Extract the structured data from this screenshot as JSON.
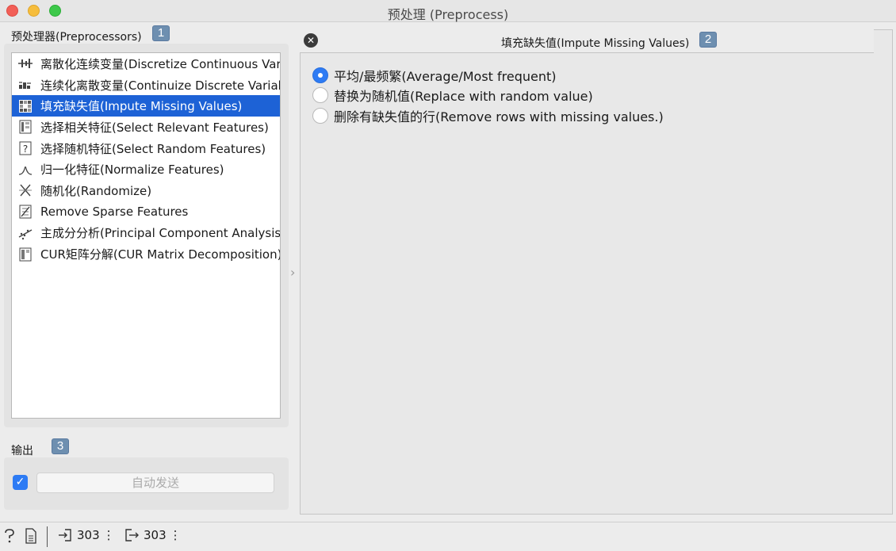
{
  "window": {
    "title": "预处理 (Preprocess)"
  },
  "preprocessors": {
    "label": "预处理器(Preprocessors)",
    "badge": "1",
    "items": [
      {
        "label": "离散化连续变量(Discretize Continuous Variables)",
        "icon": "discretize-icon"
      },
      {
        "label": "连续化离散变量(Continuize Discrete Variables)",
        "icon": "continuize-icon"
      },
      {
        "label": "填充缺失值(Impute Missing Values)",
        "icon": "impute-icon",
        "selected": true
      },
      {
        "label": "选择相关特征(Select Relevant Features)",
        "icon": "select-relevant-icon"
      },
      {
        "label": "选择随机特征(Select Random Features)",
        "icon": "select-random-icon"
      },
      {
        "label": "归一化特征(Normalize Features)",
        "icon": "normalize-icon"
      },
      {
        "label": "随机化(Randomize)",
        "icon": "randomize-icon"
      },
      {
        "label": "Remove Sparse Features",
        "icon": "remove-sparse-icon"
      },
      {
        "label": "主成分分析(Principal Component Analysis)",
        "icon": "pca-icon"
      },
      {
        "label": "CUR矩阵分解(CUR Matrix Decomposition)",
        "icon": "cur-icon"
      }
    ]
  },
  "output": {
    "label": "输出",
    "badge": "3",
    "auto_send_checked": true,
    "auto_send_label": "自动发送"
  },
  "editor": {
    "title": "填充缺失值(Impute Missing Values)",
    "badge": "2",
    "options": [
      {
        "label": "平均/最频繁(Average/Most frequent)",
        "checked": true
      },
      {
        "label": "替换为随机值(Replace with random value)",
        "checked": false
      },
      {
        "label": "删除有缺失值的行(Remove rows with missing values.)",
        "checked": false
      }
    ]
  },
  "statusbar": {
    "input_count": "303",
    "output_count": "303"
  },
  "colors": {
    "selection": "#1d62d6",
    "checkbox": "#2d7bf4",
    "badge": "#6e8fb0"
  }
}
